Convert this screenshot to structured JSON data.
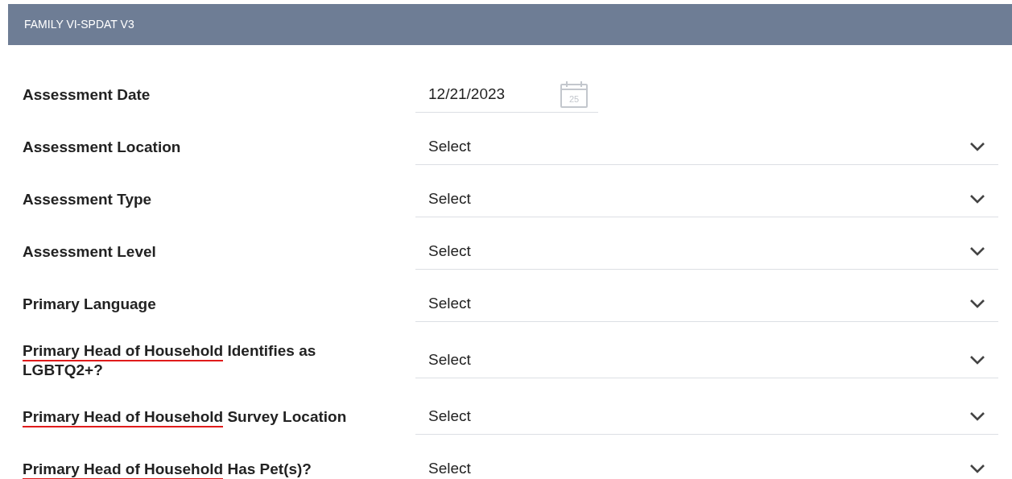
{
  "header": {
    "title": "FAMILY VI-SPDAT V3"
  },
  "fields": [
    {
      "kind": "date",
      "label_parts": [
        {
          "text": "Assessment Date",
          "flagged": false
        }
      ],
      "value": "12/21/2023",
      "calendar_day": "25"
    },
    {
      "kind": "select",
      "label_parts": [
        {
          "text": "Assessment Location",
          "flagged": false
        }
      ],
      "placeholder": "Select"
    },
    {
      "kind": "select",
      "label_parts": [
        {
          "text": "Assessment Type",
          "flagged": false
        }
      ],
      "placeholder": "Select"
    },
    {
      "kind": "select",
      "label_parts": [
        {
          "text": "Assessment Level",
          "flagged": false
        }
      ],
      "placeholder": "Select"
    },
    {
      "kind": "select",
      "label_parts": [
        {
          "text": "Primary Language",
          "flagged": false
        }
      ],
      "placeholder": "Select"
    },
    {
      "kind": "select",
      "label_parts": [
        {
          "text": "Primary Head of Household",
          "flagged": true
        },
        {
          "text": " Identifies as LGBTQ2+?",
          "flagged": false
        }
      ],
      "placeholder": "Select"
    },
    {
      "kind": "select",
      "label_parts": [
        {
          "text": "Primary Head of Household",
          "flagged": true
        },
        {
          "text": " Survey Location",
          "flagged": false
        }
      ],
      "placeholder": "Select"
    },
    {
      "kind": "select",
      "label_parts": [
        {
          "text": "Primary Head of Household",
          "flagged": true
        },
        {
          "text": " Has Pet(s)?",
          "flagged": false
        }
      ],
      "placeholder": "Select"
    }
  ]
}
